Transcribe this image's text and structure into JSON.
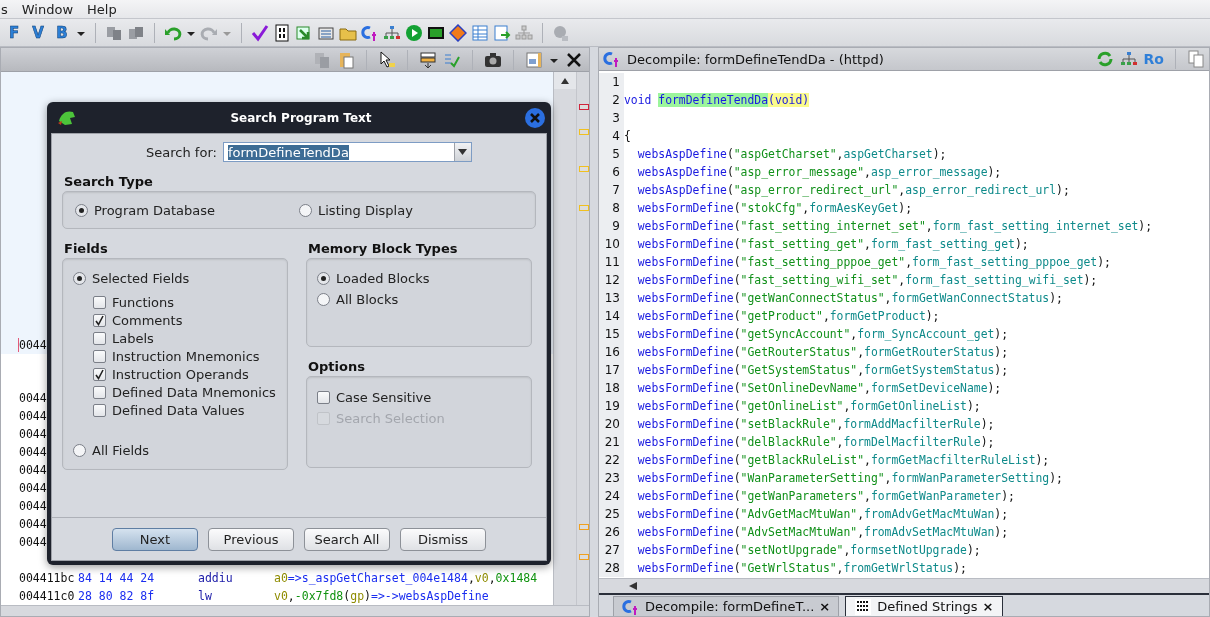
{
  "menu": [
    {
      "label": "s"
    },
    {
      "label": "Window"
    },
    {
      "label": "Help"
    }
  ],
  "toolbar_letters": [
    "F",
    "V",
    "B"
  ],
  "listing": {
    "cursor_row": {
      "address": "0044"
    },
    "partial_rows": [
      "0044",
      "0044",
      "0044",
      "0044",
      "0044",
      "0044",
      "0044",
      "0044",
      "0044"
    ],
    "rows": [
      {
        "address": "004411bc",
        "bytes": "84 14 44 24",
        "mnemonic": "addiu",
        "operands": [
          {
            "kind": "reg",
            "t": "a0"
          },
          {
            "kind": "ref",
            "t": "=>s_aspGetCharset_004e1484"
          },
          {
            "kind": "p",
            "t": ","
          },
          {
            "kind": "reg",
            "t": "v0"
          },
          {
            "kind": "p",
            "t": ","
          },
          {
            "kind": "num",
            "t": "0x1484"
          }
        ]
      },
      {
        "address": "004411c0",
        "bytes": "28 80 82 8f",
        "mnemonic": "lw",
        "operands": [
          {
            "kind": "reg",
            "t": "v0"
          },
          {
            "kind": "p",
            "t": ","
          },
          {
            "kind": "num",
            "t": "-0x7fd8"
          },
          {
            "kind": "p",
            "t": "("
          },
          {
            "kind": "reg",
            "t": "gp"
          },
          {
            "kind": "p",
            "t": ")"
          },
          {
            "kind": "ref",
            "t": "=>->websAspDefine"
          }
        ]
      }
    ]
  },
  "dialog": {
    "title": "Search Program Text",
    "search_label": "Search for:",
    "search_value": "formDefineTendDa",
    "search_type": {
      "title": "Search Type",
      "options": [
        {
          "label": "Program Database",
          "selected": true
        },
        {
          "label": "Listing Display",
          "selected": false
        }
      ]
    },
    "fields": {
      "title": "Fields",
      "selected_fields": {
        "label": "Selected Fields",
        "selected": true
      },
      "checkboxes": [
        {
          "label": "Functions",
          "checked": false
        },
        {
          "label": "Comments",
          "checked": true
        },
        {
          "label": "Labels",
          "checked": false
        },
        {
          "label": "Instruction Mnemonics",
          "checked": false
        },
        {
          "label": "Instruction Operands",
          "checked": true
        },
        {
          "label": "Defined Data Mnemonics",
          "checked": false
        },
        {
          "label": "Defined Data Values",
          "checked": false
        }
      ],
      "all_fields": {
        "label": "All Fields",
        "selected": false
      }
    },
    "memory": {
      "title": "Memory Block Types",
      "options": [
        {
          "label": "Loaded Blocks",
          "selected": true
        },
        {
          "label": "All Blocks",
          "selected": false
        }
      ]
    },
    "options": {
      "title": "Options",
      "checkboxes": [
        {
          "label": "Case Sensitive",
          "checked": false,
          "disabled": false
        },
        {
          "label": "Search Selection",
          "checked": false,
          "disabled": true
        }
      ]
    },
    "buttons": [
      {
        "label": "Next",
        "default": true
      },
      {
        "label": "Previous",
        "default": false
      },
      {
        "label": "Search All",
        "default": false
      },
      {
        "label": "Dismiss",
        "default": false
      }
    ]
  },
  "decompile": {
    "title": "Decompile: formDefineTendDa -  (httpd)",
    "toolbar_text": "Ro",
    "lines": [
      {
        "n": "1"
      },
      {
        "n": "2",
        "tokens": [
          {
            "kind": "kw",
            "t": "void "
          },
          {
            "kind": "hlname",
            "t": "formDefineTendDa"
          },
          {
            "kind": "hlsig",
            "t": "(void)"
          }
        ]
      },
      {
        "n": "3"
      },
      {
        "n": "4",
        "tokens": [
          {
            "kind": "p",
            "t": "{"
          }
        ]
      },
      {
        "n": "5",
        "tokens": [
          {
            "kind": "fn",
            "t": "  websAspDefine"
          },
          {
            "kind": "p",
            "t": "("
          },
          {
            "kind": "str",
            "t": "\"aspGetCharset\""
          },
          {
            "kind": "p",
            "t": ","
          },
          {
            "kind": "id",
            "t": "aspGetCharset"
          },
          {
            "kind": "p",
            "t": ");"
          }
        ]
      },
      {
        "n": "6",
        "tokens": [
          {
            "kind": "fn",
            "t": "  websAspDefine"
          },
          {
            "kind": "p",
            "t": "("
          },
          {
            "kind": "str",
            "t": "\"asp_error_message\""
          },
          {
            "kind": "p",
            "t": ","
          },
          {
            "kind": "id",
            "t": "asp_error_message"
          },
          {
            "kind": "p",
            "t": ");"
          }
        ]
      },
      {
        "n": "7",
        "tokens": [
          {
            "kind": "fn",
            "t": "  websAspDefine"
          },
          {
            "kind": "p",
            "t": "("
          },
          {
            "kind": "str",
            "t": "\"asp_error_redirect_url\""
          },
          {
            "kind": "p",
            "t": ","
          },
          {
            "kind": "id",
            "t": "asp_error_redirect_url"
          },
          {
            "kind": "p",
            "t": ");"
          }
        ]
      },
      {
        "n": "8",
        "tokens": [
          {
            "kind": "fn",
            "t": "  websFormDefine"
          },
          {
            "kind": "p",
            "t": "("
          },
          {
            "kind": "str",
            "t": "\"stokCfg\""
          },
          {
            "kind": "p",
            "t": ","
          },
          {
            "kind": "id",
            "t": "formAesKeyGet"
          },
          {
            "kind": "p",
            "t": ");"
          }
        ]
      },
      {
        "n": "9",
        "tokens": [
          {
            "kind": "fn",
            "t": "  websFormDefine"
          },
          {
            "kind": "p",
            "t": "("
          },
          {
            "kind": "str",
            "t": "\"fast_setting_internet_set\""
          },
          {
            "kind": "p",
            "t": ","
          },
          {
            "kind": "id",
            "t": "form_fast_setting_internet_set"
          },
          {
            "kind": "p",
            "t": ");"
          }
        ]
      },
      {
        "n": "10",
        "tokens": [
          {
            "kind": "fn",
            "t": "  websFormDefine"
          },
          {
            "kind": "p",
            "t": "("
          },
          {
            "kind": "str",
            "t": "\"fast_setting_get\""
          },
          {
            "kind": "p",
            "t": ","
          },
          {
            "kind": "id",
            "t": "form_fast_setting_get"
          },
          {
            "kind": "p",
            "t": ");"
          }
        ]
      },
      {
        "n": "11",
        "tokens": [
          {
            "kind": "fn",
            "t": "  websFormDefine"
          },
          {
            "kind": "p",
            "t": "("
          },
          {
            "kind": "str",
            "t": "\"fast_setting_pppoe_get\""
          },
          {
            "kind": "p",
            "t": ","
          },
          {
            "kind": "id",
            "t": "form_fast_setting_pppoe_get"
          },
          {
            "kind": "p",
            "t": ");"
          }
        ]
      },
      {
        "n": "12",
        "tokens": [
          {
            "kind": "fn",
            "t": "  websFormDefine"
          },
          {
            "kind": "p",
            "t": "("
          },
          {
            "kind": "str",
            "t": "\"fast_setting_wifi_set\""
          },
          {
            "kind": "p",
            "t": ","
          },
          {
            "kind": "id",
            "t": "form_fast_setting_wifi_set"
          },
          {
            "kind": "p",
            "t": ");"
          }
        ]
      },
      {
        "n": "13",
        "tokens": [
          {
            "kind": "fn",
            "t": "  websFormDefine"
          },
          {
            "kind": "p",
            "t": "("
          },
          {
            "kind": "str",
            "t": "\"getWanConnectStatus\""
          },
          {
            "kind": "p",
            "t": ","
          },
          {
            "kind": "id",
            "t": "formGetWanConnectStatus"
          },
          {
            "kind": "p",
            "t": ");"
          }
        ]
      },
      {
        "n": "14",
        "tokens": [
          {
            "kind": "fn",
            "t": "  websFormDefine"
          },
          {
            "kind": "p",
            "t": "("
          },
          {
            "kind": "str",
            "t": "\"getProduct\""
          },
          {
            "kind": "p",
            "t": ","
          },
          {
            "kind": "id",
            "t": "formGetProduct"
          },
          {
            "kind": "p",
            "t": ");"
          }
        ]
      },
      {
        "n": "15",
        "tokens": [
          {
            "kind": "fn",
            "t": "  websFormDefine"
          },
          {
            "kind": "p",
            "t": "("
          },
          {
            "kind": "str",
            "t": "\"getSyncAccount\""
          },
          {
            "kind": "p",
            "t": ","
          },
          {
            "kind": "id",
            "t": "form_SyncAccount_get"
          },
          {
            "kind": "p",
            "t": ");"
          }
        ]
      },
      {
        "n": "16",
        "tokens": [
          {
            "kind": "fn",
            "t": "  websFormDefine"
          },
          {
            "kind": "p",
            "t": "("
          },
          {
            "kind": "str",
            "t": "\"GetRouterStatus\""
          },
          {
            "kind": "p",
            "t": ","
          },
          {
            "kind": "id",
            "t": "formGetRouterStatus"
          },
          {
            "kind": "p",
            "t": ");"
          }
        ]
      },
      {
        "n": "17",
        "tokens": [
          {
            "kind": "fn",
            "t": "  websFormDefine"
          },
          {
            "kind": "p",
            "t": "("
          },
          {
            "kind": "str",
            "t": "\"GetSystemStatus\""
          },
          {
            "kind": "p",
            "t": ","
          },
          {
            "kind": "id",
            "t": "formGetSystemStatus"
          },
          {
            "kind": "p",
            "t": ");"
          }
        ]
      },
      {
        "n": "18",
        "tokens": [
          {
            "kind": "fn",
            "t": "  websFormDefine"
          },
          {
            "kind": "p",
            "t": "("
          },
          {
            "kind": "str",
            "t": "\"SetOnlineDevName\""
          },
          {
            "kind": "p",
            "t": ","
          },
          {
            "kind": "id",
            "t": "formSetDeviceName"
          },
          {
            "kind": "p",
            "t": ");"
          }
        ]
      },
      {
        "n": "19",
        "tokens": [
          {
            "kind": "fn",
            "t": "  websFormDefine"
          },
          {
            "kind": "p",
            "t": "("
          },
          {
            "kind": "str",
            "t": "\"getOnlineList\""
          },
          {
            "kind": "p",
            "t": ","
          },
          {
            "kind": "id",
            "t": "formGetOnlineList"
          },
          {
            "kind": "p",
            "t": ");"
          }
        ]
      },
      {
        "n": "20",
        "tokens": [
          {
            "kind": "fn",
            "t": "  websFormDefine"
          },
          {
            "kind": "p",
            "t": "("
          },
          {
            "kind": "str",
            "t": "\"setBlackRule\""
          },
          {
            "kind": "p",
            "t": ","
          },
          {
            "kind": "id",
            "t": "formAddMacfilterRule"
          },
          {
            "kind": "p",
            "t": ");"
          }
        ]
      },
      {
        "n": "21",
        "tokens": [
          {
            "kind": "fn",
            "t": "  websFormDefine"
          },
          {
            "kind": "p",
            "t": "("
          },
          {
            "kind": "str",
            "t": "\"delBlackRule\""
          },
          {
            "kind": "p",
            "t": ","
          },
          {
            "kind": "id",
            "t": "formDelMacfilterRule"
          },
          {
            "kind": "p",
            "t": ");"
          }
        ]
      },
      {
        "n": "22",
        "tokens": [
          {
            "kind": "fn",
            "t": "  websFormDefine"
          },
          {
            "kind": "p",
            "t": "("
          },
          {
            "kind": "str",
            "t": "\"getBlackRuleList\""
          },
          {
            "kind": "p",
            "t": ","
          },
          {
            "kind": "id",
            "t": "formGetMacfilterRuleList"
          },
          {
            "kind": "p",
            "t": ");"
          }
        ]
      },
      {
        "n": "23",
        "tokens": [
          {
            "kind": "fn",
            "t": "  websFormDefine"
          },
          {
            "kind": "p",
            "t": "("
          },
          {
            "kind": "str",
            "t": "\"WanParameterSetting\""
          },
          {
            "kind": "p",
            "t": ","
          },
          {
            "kind": "id",
            "t": "formWanParameterSetting"
          },
          {
            "kind": "p",
            "t": ");"
          }
        ]
      },
      {
        "n": "24",
        "tokens": [
          {
            "kind": "fn",
            "t": "  websFormDefine"
          },
          {
            "kind": "p",
            "t": "("
          },
          {
            "kind": "str",
            "t": "\"getWanParameters\""
          },
          {
            "kind": "p",
            "t": ","
          },
          {
            "kind": "id",
            "t": "formGetWanParameter"
          },
          {
            "kind": "p",
            "t": ");"
          }
        ]
      },
      {
        "n": "25",
        "tokens": [
          {
            "kind": "fn",
            "t": "  websFormDefine"
          },
          {
            "kind": "p",
            "t": "("
          },
          {
            "kind": "str",
            "t": "\"AdvGetMacMtuWan\""
          },
          {
            "kind": "p",
            "t": ","
          },
          {
            "kind": "id",
            "t": "fromAdvGetMacMtuWan"
          },
          {
            "kind": "p",
            "t": ");"
          }
        ]
      },
      {
        "n": "26",
        "tokens": [
          {
            "kind": "fn",
            "t": "  websFormDefine"
          },
          {
            "kind": "p",
            "t": "("
          },
          {
            "kind": "str",
            "t": "\"AdvSetMacMtuWan\""
          },
          {
            "kind": "p",
            "t": ","
          },
          {
            "kind": "id",
            "t": "fromAdvSetMacMtuWan"
          },
          {
            "kind": "p",
            "t": ");"
          }
        ]
      },
      {
        "n": "27",
        "tokens": [
          {
            "kind": "fn",
            "t": "  websFormDefine"
          },
          {
            "kind": "p",
            "t": "("
          },
          {
            "kind": "str",
            "t": "\"setNotUpgrade\""
          },
          {
            "kind": "p",
            "t": ","
          },
          {
            "kind": "id",
            "t": "formsetNotUpgrade"
          },
          {
            "kind": "p",
            "t": ");"
          }
        ]
      },
      {
        "n": "28",
        "tokens": [
          {
            "kind": "fn",
            "t": "  websFormDefine"
          },
          {
            "kind": "p",
            "t": "("
          },
          {
            "kind": "str",
            "t": "\"GetWrlStatus\""
          },
          {
            "kind": "p",
            "t": ","
          },
          {
            "kind": "id",
            "t": "fromGetWrlStatus"
          },
          {
            "kind": "p",
            "t": ");"
          }
        ]
      }
    ]
  },
  "bottom_tabs": [
    {
      "label": "Decompile: formDefineT...",
      "close": "×",
      "selected": false,
      "kind": "decompiler"
    },
    {
      "label": "Defined Strings",
      "close": "×",
      "selected": true,
      "kind": "data"
    }
  ]
}
